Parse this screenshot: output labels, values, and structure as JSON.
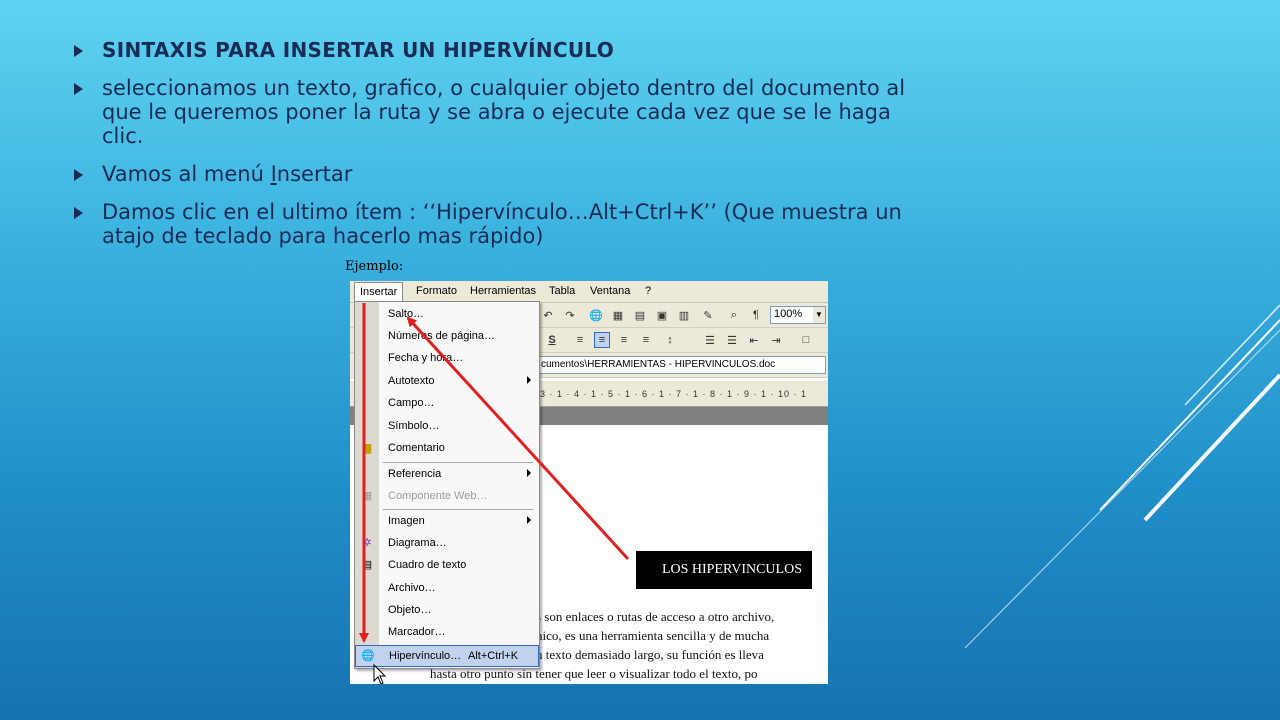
{
  "slide": {
    "bullets": [
      {
        "text": "SINTAXIS PARA INSERTAR UN HIPERVÍNCULO",
        "style": "heading"
      },
      {
        "text": "seleccionamos un texto, grafico, o cualquier objeto dentro del documento al que le queremos poner la ruta y se abra o ejecute cada vez que se le haga clic."
      },
      {
        "text_before": "Vamos al menú ",
        "text_underlined": "I",
        "text_after": "nsertar"
      },
      {
        "text": "Damos clic en el ultimo ítem : ‘‘Hipervínculo…Alt+Ctrl+K’’ (Que muestra un atajo de teclado para hacerlo mas rápido)"
      }
    ],
    "example_label": "Ejemplo:"
  },
  "app": {
    "menubar": [
      "Insertar",
      "Formato",
      "Herramientas",
      "Tabla",
      "Ventana",
      "?"
    ],
    "zoom": "100%",
    "path": "cumentos\\HERRAMIENTAS - HIPERVINCULOS.doc",
    "ruler": "3 · 1 · 4 · 1 · 5 · 1 · 6 · 1 · 7 · 1 · 8 · 1 · 9 · 1 · 10 · 1",
    "menu_items": [
      {
        "label": "Salto…"
      },
      {
        "label": "Números de página…"
      },
      {
        "label": "Fecha y hora…"
      },
      {
        "label": "Autotexto"
      },
      {
        "label": "Campo…"
      },
      {
        "label": "Símbolo…"
      },
      {
        "label": "Comentario"
      },
      {
        "label": "Referencia"
      },
      {
        "label": "Componente Web…"
      },
      {
        "label": "Imagen"
      },
      {
        "label": "Diagrama…"
      },
      {
        "label": "Cuadro de texto"
      },
      {
        "label": "Archivo…"
      },
      {
        "label": "Objeto…"
      },
      {
        "label": "Marcador…"
      },
      {
        "label": "Hipervínculo…",
        "accelerator": "Alt+Ctrl+K"
      }
    ],
    "document": {
      "title_box": "LOS HIPERVINCULOS",
      "lines": [
        "s son enlaces o rutas de acceso a otro archivo,",
        "nico, es una herramienta sencilla y de mucha",
        "n texto demasiado largo, su función es lleva",
        "hasta otro punto sin tener que leer o visualizar todo el texto, po"
      ]
    }
  },
  "colors": {
    "slide_text": "#1a2c55",
    "annotation_arrow": "#e02020",
    "menu_highlight": "#c1d2ee"
  }
}
